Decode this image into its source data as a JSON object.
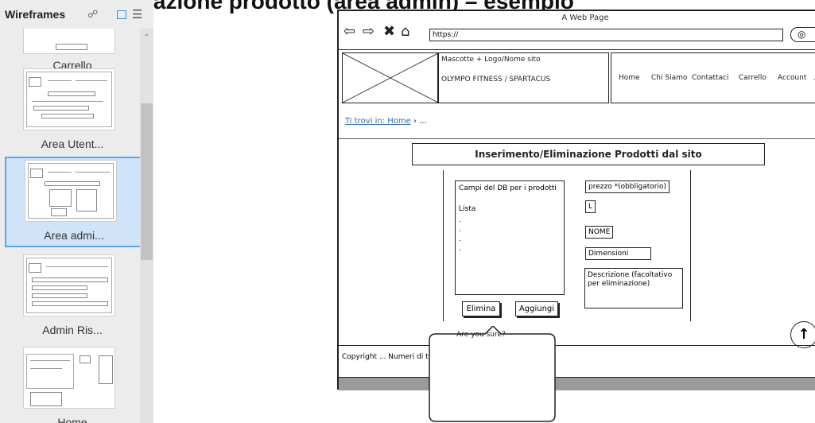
{
  "top_cut_text": "ggiunta/Eliminazione prodotto (area admin) – esempio",
  "panel": {
    "title": "Wireframes",
    "thumbnails": [
      {
        "label": "Carrello"
      },
      {
        "label": "Area Utent..."
      },
      {
        "label": "Area admi..."
      },
      {
        "label": "Admin Ris..."
      },
      {
        "label": "Home"
      }
    ]
  },
  "browser": {
    "title": "A Web Page",
    "url": "https://",
    "mascot_text": "Mascotte + Logo/Nome sito",
    "site_name": "OLYMPO FITNESS / SPARTACUS",
    "nav": [
      "Home",
      "Chi Siamo",
      "Contattaci",
      "Carrello",
      "Account",
      "..."
    ],
    "breadcrumb_link": "Ti trovi in: Home",
    "breadcrumb_rest": " › ...",
    "section_title": "Inserimento/Eliminazione Prodotti dal sito",
    "db_fields_title": "Campi del DB per i prodotti",
    "db_list_label": "Lista",
    "fields": {
      "price": "prezzo *(obbligatorio)",
      "size": "L",
      "name": "NOME",
      "dimensions": "Dimensioni",
      "description": "Descrizione (facoltativo per eliminazione)"
    },
    "buttons": {
      "delete": "Elimina",
      "add": "Aggiungi"
    },
    "tooltip": "Are you sure?",
    "copyright": "Copyright ... Numeri di t"
  }
}
